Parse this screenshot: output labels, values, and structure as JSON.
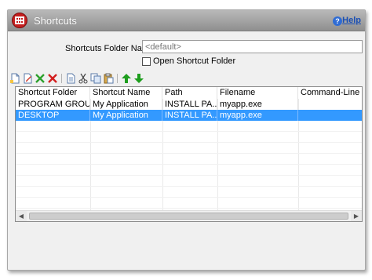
{
  "window": {
    "title": "Shortcuts",
    "help_label": "Help"
  },
  "form": {
    "folder_name_label": "Shortcuts Folder Name:",
    "folder_name_value": "",
    "folder_name_placeholder": "<default>",
    "open_folder_label": "Open Shortcut Folder",
    "open_folder_checked": false
  },
  "toolbar": {
    "buttons": [
      "new-icon",
      "edit-icon",
      "add-icon",
      "delete-icon",
      "properties-icon",
      "cut-icon",
      "copy-icon",
      "paste-icon",
      "move-up-icon",
      "move-down-icon"
    ]
  },
  "table": {
    "columns": [
      "Shortcut Folder",
      "Shortcut Name",
      "Path",
      "Filename",
      "Command-Line Par"
    ],
    "rows": [
      [
        "PROGRAM GROUP",
        "My Application",
        "INSTALL PA...",
        "myapp.exe",
        ""
      ],
      [
        "DESKTOP",
        "My Application",
        "INSTALL PA...",
        "myapp.exe",
        ""
      ]
    ],
    "selected_row": 1
  },
  "colors": {
    "title_bar": "#8f8f8f",
    "selection": "#3399ff",
    "app_icon": "#c41f1f"
  }
}
